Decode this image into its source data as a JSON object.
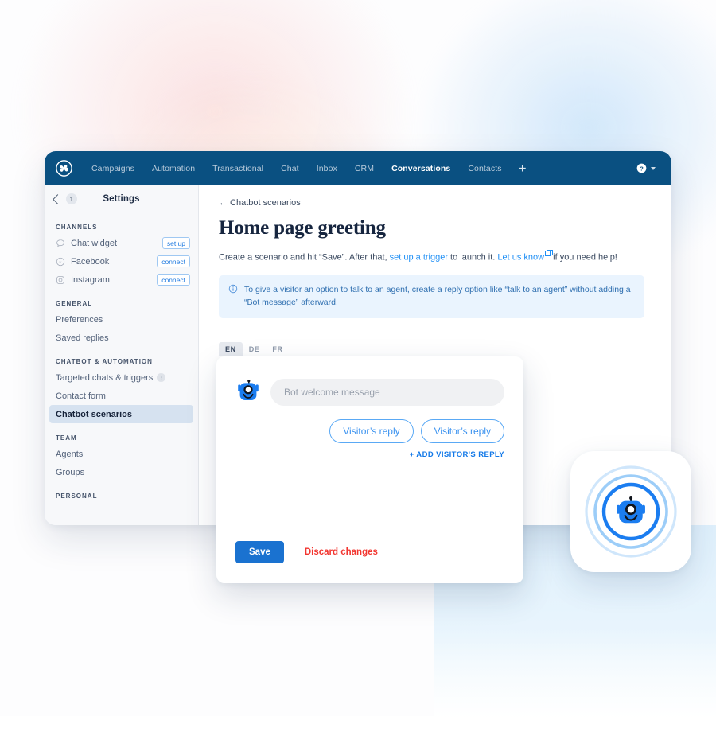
{
  "navbar": {
    "logo_icon": "brevo-pinwheel-logo",
    "items": [
      {
        "label": "Campaigns",
        "active": false
      },
      {
        "label": "Automation",
        "active": false
      },
      {
        "label": "Transactional",
        "active": false
      },
      {
        "label": "Chat",
        "active": false
      },
      {
        "label": "Inbox",
        "active": false
      },
      {
        "label": "CRM",
        "active": false
      },
      {
        "label": "Conversations",
        "active": true
      },
      {
        "label": "Contacts",
        "active": false
      }
    ],
    "add_label": "+",
    "help_icon": "help-circle-icon",
    "caret_icon": "chevron-down-icon"
  },
  "sidebar": {
    "back_icon": "chevron-left-icon",
    "back_badge": "1",
    "title": "Settings",
    "groups": [
      {
        "label": "CHANNELS",
        "items": [
          {
            "label": "Chat widget",
            "icon": "chat-bubble-icon",
            "pill": "set up",
            "selected": false
          },
          {
            "label": "Facebook",
            "icon": "messenger-icon",
            "pill": "connect",
            "selected": false
          },
          {
            "label": "Instagram",
            "icon": "instagram-icon",
            "pill": "connect",
            "selected": false
          }
        ]
      },
      {
        "label": "GENERAL",
        "items": [
          {
            "label": "Preferences",
            "selected": false
          },
          {
            "label": "Saved replies",
            "selected": false
          }
        ]
      },
      {
        "label": "CHATBOT & AUTOMATION",
        "items": [
          {
            "label": "Targeted chats & triggers",
            "info": "i",
            "selected": false
          },
          {
            "label": "Contact form",
            "selected": false
          },
          {
            "label": "Chatbot scenarios",
            "selected": true
          }
        ]
      },
      {
        "label": "TEAM",
        "items": [
          {
            "label": "Agents",
            "selected": false
          },
          {
            "label": "Groups",
            "selected": false
          }
        ]
      },
      {
        "label": "PERSONAL",
        "items": []
      }
    ]
  },
  "main": {
    "breadcrumb": "← Chatbot scenarios",
    "title": "Home page greeting",
    "description": {
      "part1": "Create a scenario and hit “Save”. After that, ",
      "link1": "set up a trigger",
      "part2": " to launch it. ",
      "link2": "Let us know",
      "part3": " if you need help!"
    },
    "notice": {
      "icon": "info-circle-icon",
      "text": "To give a visitor an option to talk to an agent, create a reply option like “talk to an agent” without adding a “Bot message” afterward."
    },
    "language_tabs": [
      {
        "label": "EN",
        "active": true
      },
      {
        "label": "DE",
        "active": false
      },
      {
        "label": "FR",
        "active": false
      }
    ]
  },
  "editor_card": {
    "bot_avatar_icon": "bot-face-icon",
    "bot_message_placeholder": "Bot welcome message",
    "bot_message_value": "",
    "replies": [
      "Visitor’s reply",
      "Visitor’s reply"
    ],
    "add_reply_label": "+ ADD VISITOR'S REPLY",
    "save_label": "Save",
    "discard_label": "Discard changes"
  },
  "app_tile": {
    "icon": "chatbot-rings-icon"
  },
  "colors": {
    "navbar_bg": "#0a5081",
    "accent_blue": "#1a72d0",
    "link_blue": "#1f8ff5",
    "danger_red": "#f2352f",
    "notice_bg": "#eaf4fe",
    "sidebar_bg": "#f7f8fa",
    "selected_bg": "#d6e2f0"
  }
}
